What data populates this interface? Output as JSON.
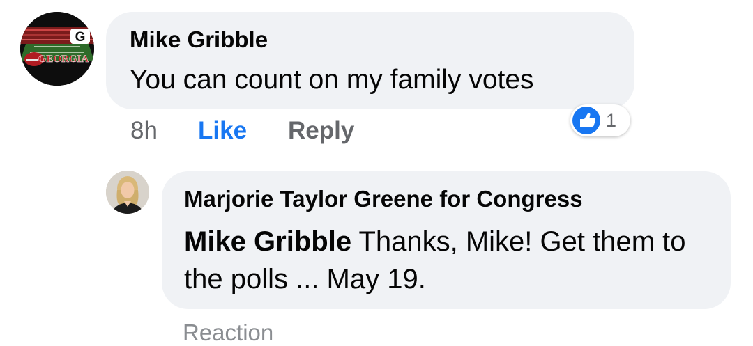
{
  "comments": [
    {
      "author": "Mike Gribble",
      "text": "You can count on my family votes",
      "time": "8h",
      "like_label": "Like",
      "reply_label": "Reply",
      "reaction": {
        "icon": "thumbs-up-icon",
        "count": "1"
      }
    }
  ],
  "reply": {
    "author": "Marjorie Taylor Greene for Congress",
    "mention": "Mike Gribble",
    "text": " Thanks, Mike! Get them to the polls ... May 19."
  },
  "footer_partial_text": "Reaction",
  "colors": {
    "bubble": "#f0f2f5",
    "like_blue": "#1877f2",
    "meta_gray": "#65676b",
    "text": "#050505"
  }
}
